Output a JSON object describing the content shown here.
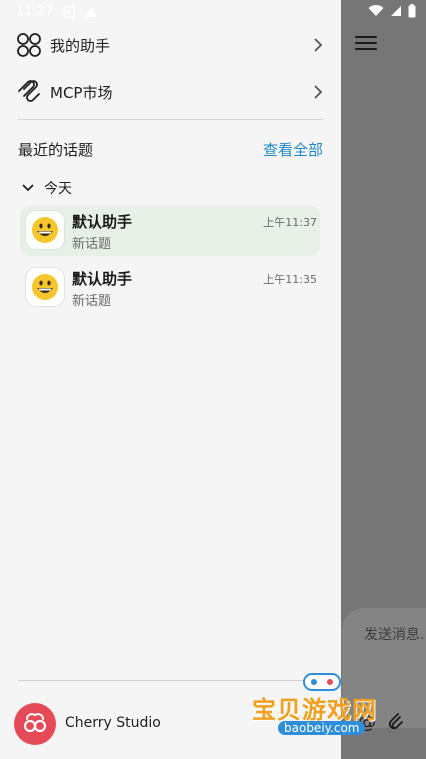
{
  "status_bar": {
    "time": "11:27"
  },
  "nav": {
    "assistants_label": "我的助手",
    "mcp_label": "MCP市场"
  },
  "recent": {
    "title": "最近的话题",
    "view_all": "查看全部",
    "group": "今天",
    "topics": [
      {
        "name": "默认助手",
        "subtitle": "新话题",
        "time": "上午11:37",
        "active": true
      },
      {
        "name": "默认助手",
        "subtitle": "新话题",
        "time": "上午11:35",
        "active": false
      }
    ]
  },
  "footer": {
    "app_name": "Cherry Studio"
  },
  "main": {
    "input_placeholder": "发送消息..."
  },
  "watermark": {
    "title": "宝贝游戏网",
    "url": "baobeiy.com"
  },
  "colors": {
    "accent": "#1e88c9",
    "active_bg": "#e6f0e6",
    "logo": "#e54b57"
  }
}
